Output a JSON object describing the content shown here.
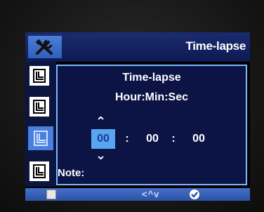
{
  "header": {
    "title": "Time-lapse",
    "icon": "tools-icon"
  },
  "sidebar": {
    "items": [
      {
        "icon": "menu-page-icon",
        "selected": false
      },
      {
        "icon": "menu-page-icon",
        "selected": false
      },
      {
        "icon": "menu-page-icon",
        "selected": true
      },
      {
        "icon": "menu-page-icon",
        "selected": false
      }
    ]
  },
  "panel": {
    "title": "Time-lapse",
    "format_label": "Hour:Min:Sec",
    "hour": "00",
    "minute": "00",
    "second": "00",
    "separator": ":",
    "note_label": "Note:"
  },
  "footer": {
    "nav_hint": "<^v",
    "ok_icon": "check-icon",
    "doc_icon": "document-icon"
  },
  "colors": {
    "header_bg": "#1b2b70",
    "panel_border": "#7bb8ff",
    "active_field": "#58a6f0",
    "footer_bg": "#4570c8"
  }
}
